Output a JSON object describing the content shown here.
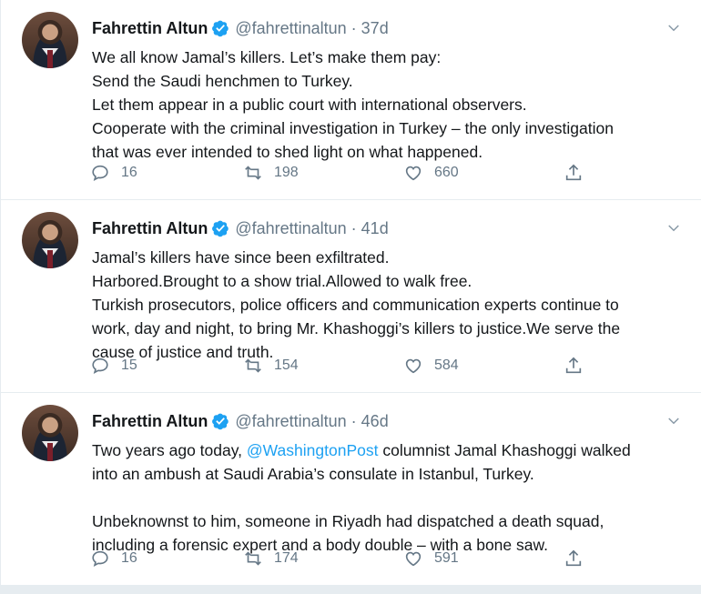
{
  "colors": {
    "text": "#14171a",
    "secondary": "#657786",
    "accent": "#1da1f2",
    "divider": "#e6ecf0"
  },
  "tweets": [
    {
      "author": {
        "name": "Fahrettin Altun",
        "handle": "@fahrettinaltun",
        "verified": true
      },
      "separator": "·",
      "time": "37d",
      "lines": [
        "We all know Jamal’s killers. Let’s make them pay:",
        "Send the Saudi henchmen to Turkey.",
        "Let them appear in a public court with international observers.",
        "Cooperate with the criminal investigation in Turkey – the only investigation",
        "that was ever intended to shed light on what happened."
      ],
      "stats": {
        "replies": "16",
        "retweets": "198",
        "likes": "660"
      }
    },
    {
      "author": {
        "name": "Fahrettin Altun",
        "handle": "@fahrettinaltun",
        "verified": true
      },
      "separator": "·",
      "time": "41d",
      "lines": [
        "Jamal’s killers have since been exfiltrated.",
        "Harbored.Brought to a show trial.Allowed to walk free.",
        "Turkish prosecutors, police officers and communication experts continue to",
        "work, day and night, to bring Mr. Khashoggi’s killers to justice.We serve the",
        "cause of justice and truth."
      ],
      "stats": {
        "replies": "15",
        "retweets": "154",
        "likes": "584"
      }
    },
    {
      "author": {
        "name": "Fahrettin Altun",
        "handle": "@fahrettinaltun",
        "verified": true
      },
      "separator": "·",
      "time": "46d",
      "line1_prefix": "Two years ago today, ",
      "line1_mention": "@WashingtonPost",
      "line1_suffix": " columnist Jamal Khashoggi walked",
      "lines": [
        "into an ambush at Saudi Arabia’s consulate in Istanbul, Turkey.",
        "Unbeknownst to him, someone in Riyadh had dispatched a death squad,",
        "including a forensic expert and a body double – with a bone saw."
      ],
      "stats": {
        "replies": "16",
        "retweets": "174",
        "likes": "591"
      }
    }
  ],
  "icons": {
    "verified": "verified-badge-icon",
    "menu": "chevron-down-icon",
    "reply": "reply-icon",
    "retweet": "retweet-icon",
    "like": "heart-icon",
    "share": "share-icon"
  }
}
